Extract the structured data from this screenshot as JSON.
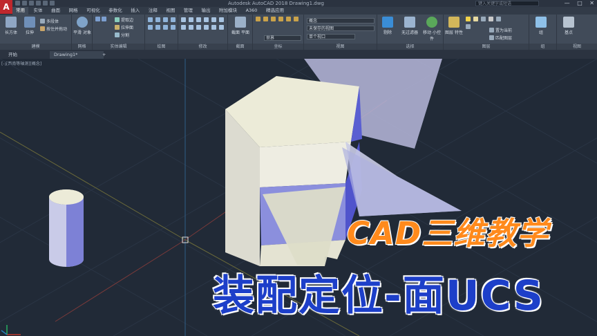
{
  "titlebar": {
    "app_letter": "A",
    "title": "Autodesk AutoCAD 2018    Drawing1.dwg",
    "search_placeholder": "键入关键字或短语",
    "win_controls": [
      "—",
      "□",
      "✕"
    ]
  },
  "menu_tabs": [
    "常用",
    "实体",
    "曲面",
    "网格",
    "可视化",
    "参数化",
    "插入",
    "注释",
    "视图",
    "管理",
    "输出",
    "附加模块",
    "A360",
    "精选应用"
  ],
  "ribbon": {
    "modeling": {
      "title": "建模",
      "box_label": "长方体",
      "extrude_label": "拉伸",
      "polysolid_label": "多段体",
      "presspull_label": "按住并拖动"
    },
    "mesh": {
      "title": "网格",
      "smooth_label": "平滑\n对象"
    },
    "solid_edit": {
      "title": "实体编辑",
      "extract_edges": "提取边",
      "extrude_faces": "拉伸面",
      "separate": "分割"
    },
    "draw": {
      "title": "绘图"
    },
    "modify": {
      "title": "修改"
    },
    "section": {
      "title": "截面",
      "plane_label": "截面\n平面"
    },
    "coordinates": {
      "title": "坐标",
      "world": "世界"
    },
    "view": {
      "title": "视图",
      "visual_style": "概念",
      "saved_view": "未保存的视图",
      "viewport": "单个视口"
    },
    "selection": {
      "title": "选择",
      "culling_label": "剔除",
      "no_filter_label": "无过滤器",
      "gizmo_label": "移动\n小控件"
    },
    "layers": {
      "title": "图层",
      "layer_props": "图层\n特性",
      "set_current": "置为当前",
      "match_layer": "匹配图层"
    },
    "groups": {
      "title": "组",
      "label": "组"
    },
    "view2": {
      "title": "视图",
      "base_label": "基点"
    }
  },
  "doc_tabs": [
    "开始",
    "Drawing1*"
  ],
  "viewport": {
    "label": "[-][西南等轴测][概念]"
  },
  "captions": {
    "line1": "CAD三维教学",
    "line2": "装配定位-面UCS"
  },
  "colors": {
    "caption1": "#ff8a1c",
    "caption2": "#1d3fc9",
    "face_light": "#ecebd8",
    "face_blue": "#8b8fdd",
    "canvas": "#212a37"
  }
}
